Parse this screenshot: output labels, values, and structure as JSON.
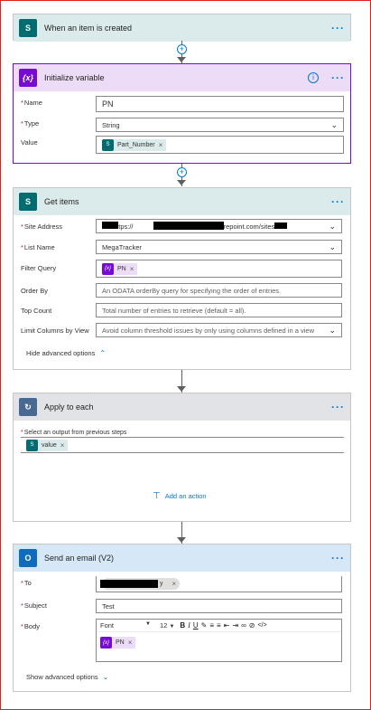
{
  "trigger": {
    "title": "When an item is created",
    "icon": "sharepoint-icon"
  },
  "init_variable": {
    "title": "Initialize variable",
    "icon_text": "{x}",
    "name_label": "Name",
    "name_value": "PN",
    "type_label": "Type",
    "type_value": "String",
    "value_label": "Value",
    "value_token": "Part_Number"
  },
  "get_items": {
    "title": "Get items",
    "site_label": "Site Address",
    "site_value": "https://",
    "site_value_2": "sharepoint.com/sites/",
    "list_label": "List Name",
    "list_value": "MegaTracker",
    "filter_label": "Filter Query",
    "filter_token": "PN",
    "orderby_label": "Order By",
    "orderby_placeholder": "An ODATA orderBy query for specifying the order of entries.",
    "top_label": "Top Count",
    "top_placeholder": "Total number of entries to retrieve (default = all).",
    "limit_label": "Limit Columns by View",
    "limit_placeholder": "Avoid column threshold issues by only using columns defined in a view",
    "advanced_link": "Hide advanced options"
  },
  "apply_each": {
    "title": "Apply to each",
    "select_label": "Select an output from previous steps",
    "token": "value",
    "add_action": "Add an action"
  },
  "send_email": {
    "title": "Send an email (V2)",
    "to_label": "To",
    "to_value": "y",
    "subject_label": "Subject",
    "subject_value": "Test",
    "body_label": "Body",
    "font_value": "Font",
    "font_size": "12",
    "body_token": "PN",
    "advanced_link": "Show advanced options"
  },
  "colors": {
    "sharepoint": "#036c70",
    "variable": "#770bd6",
    "loop": "#486991",
    "outlook": "#0f6cbd",
    "accent": "#0078d4",
    "frame_border": "#e0201b"
  }
}
